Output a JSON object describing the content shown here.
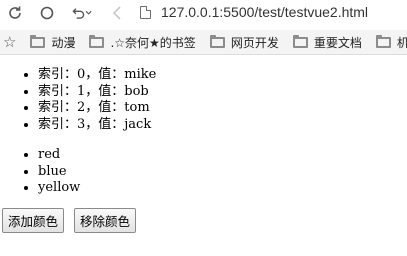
{
  "browser": {
    "url": "127.0.0.1:5500/test/testvue2.html",
    "icons": [
      "reload-icon",
      "history-back-icon",
      "back-icon",
      "page-icon",
      "star-icon",
      "folder-icon"
    ],
    "bookmarks": [
      {
        "label": "动漫"
      },
      {
        "label": ".☆奈何★的书签"
      },
      {
        "label": "网页开发"
      },
      {
        "label": "重要文档"
      },
      {
        "label": "机器"
      }
    ]
  },
  "page": {
    "index_items": [
      "索引：0，值：mike",
      "索引：1，值：bob",
      "索引：2，值：tom",
      "索引：3，值：jack"
    ],
    "colors": [
      "red",
      "blue",
      "yellow"
    ],
    "add_button": "添加颜色",
    "remove_button": "移除颜色"
  }
}
